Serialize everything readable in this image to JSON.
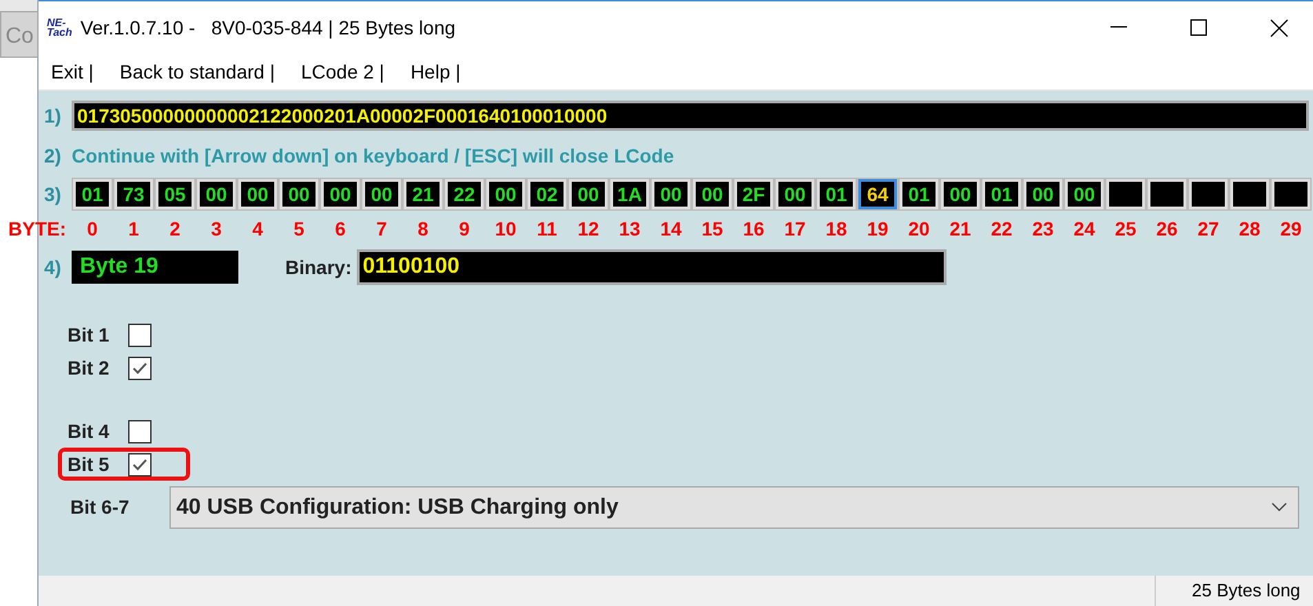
{
  "background_window": {
    "button_label": "Co"
  },
  "window": {
    "logo_lines": [
      "NE-",
      "Tach"
    ],
    "title": "Ver.1.0.7.10 -   8V0-035-844 | 25 Bytes long"
  },
  "menu": [
    "Exit |",
    "Back to standard |",
    "LCode 2 |",
    "Help |"
  ],
  "row1": {
    "number": "1)",
    "value": "01730500000000002122000201A00002F0001640100010000"
  },
  "row2": {
    "number": "2)",
    "text": "Continue with [Arrow down] on keyboard / [ESC] will close LCode"
  },
  "row3": {
    "number": "3)",
    "byte_label": "BYTE:",
    "byte_numbers": [
      "0",
      "1",
      "2",
      "3",
      "4",
      "5",
      "6",
      "7",
      "8",
      "9",
      "10",
      "11",
      "12",
      "13",
      "14",
      "15",
      "16",
      "17",
      "18",
      "19",
      "20",
      "21",
      "22",
      "23",
      "24",
      "25",
      "26",
      "27",
      "28",
      "29"
    ],
    "bytes": [
      {
        "value": "01",
        "selected": false
      },
      {
        "value": "73",
        "selected": false
      },
      {
        "value": "05",
        "selected": false
      },
      {
        "value": "00",
        "selected": false
      },
      {
        "value": "00",
        "selected": false
      },
      {
        "value": "00",
        "selected": false
      },
      {
        "value": "00",
        "selected": false
      },
      {
        "value": "00",
        "selected": false
      },
      {
        "value": "21",
        "selected": false
      },
      {
        "value": "22",
        "selected": false
      },
      {
        "value": "00",
        "selected": false
      },
      {
        "value": "02",
        "selected": false
      },
      {
        "value": "00",
        "selected": false
      },
      {
        "value": "1A",
        "selected": false
      },
      {
        "value": "00",
        "selected": false
      },
      {
        "value": "00",
        "selected": false
      },
      {
        "value": "2F",
        "selected": false
      },
      {
        "value": "00",
        "selected": false
      },
      {
        "value": "01",
        "selected": false
      },
      {
        "value": "64",
        "selected": true
      },
      {
        "value": "01",
        "selected": false
      },
      {
        "value": "00",
        "selected": false
      },
      {
        "value": "01",
        "selected": false
      },
      {
        "value": "00",
        "selected": false
      },
      {
        "value": "00",
        "selected": false
      }
    ]
  },
  "row4": {
    "number": "4)",
    "byte_name": "Byte 19",
    "binary_label": "Binary:",
    "binary_value": "01100100"
  },
  "bit_groups": [
    [
      {
        "label": "Bit 1",
        "checked": false,
        "highlighted": false
      },
      {
        "label": "Bit 2",
        "checked": true,
        "highlighted": false
      }
    ],
    [
      {
        "label": "Bit 4",
        "checked": false,
        "highlighted": false
      },
      {
        "label": "Bit 5",
        "checked": true,
        "highlighted": true
      }
    ]
  ],
  "bit_select": {
    "label": "Bit 6-7",
    "value": "40 USB Configuration: USB Charging only"
  },
  "status_bar": {
    "text": "25 Bytes long"
  }
}
